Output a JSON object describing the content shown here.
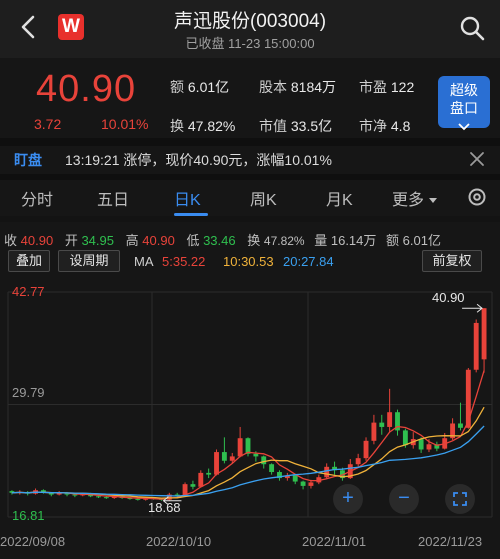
{
  "header": {
    "title": "声迅股份(003004)",
    "subtitle": "已收盘 11-23 15:00:00",
    "logo": "W"
  },
  "quote": {
    "price": "40.90",
    "change": "3.72",
    "change_pct": "10.01%",
    "items": [
      {
        "label": "额",
        "value": "6.01亿"
      },
      {
        "label": "股本",
        "value": "8184万"
      },
      {
        "label": "市盈",
        "value": "122"
      },
      {
        "label": "换",
        "value": "47.82%"
      },
      {
        "label": "市值",
        "value": "33.5亿"
      },
      {
        "label": "市净",
        "value": "4.8"
      }
    ],
    "super_button": {
      "line1": "超级",
      "line2": "盘口",
      "icon": "chevron-down-icon"
    }
  },
  "news": {
    "tag": "盯盘",
    "text": "13:19:21 涨停，现价40.90元，涨幅10.01%"
  },
  "tabs": [
    "分时",
    "五日",
    "日K",
    "周K",
    "月K",
    "更多"
  ],
  "active_tab": "日K",
  "ohlc": [
    {
      "label": "收",
      "value": "40.90",
      "color": "red"
    },
    {
      "label": "开",
      "value": "34.95",
      "color": "green"
    },
    {
      "label": "高",
      "value": "40.90",
      "color": "red"
    },
    {
      "label": "低",
      "value": "33.46",
      "color": "green"
    },
    {
      "label": "换",
      "value": "47.82%",
      "color": "plain"
    },
    {
      "label": "量",
      "value": "16.14万",
      "color": "plain"
    },
    {
      "label": "额",
      "value": "6.01亿",
      "color": "plain"
    }
  ],
  "buttons": {
    "overlay": "叠加",
    "period": "设周期",
    "adjust": "前复权"
  },
  "ma": {
    "label": "MA",
    "ma5": "5:35.22",
    "ma10": "10:30.53",
    "ma20": "20:27.84",
    "c5": "#e8433a",
    "c10": "#f0b23a",
    "c20": "#3aa0f0"
  },
  "chart_data": {
    "type": "candlestick",
    "ylim": [
      16.81,
      42.77
    ],
    "y_labels": [
      "42.77",
      "29.79",
      "16.81"
    ],
    "high_mark": "40.90",
    "low_mark": "18.68",
    "dates": [
      "2022/09/08",
      "2022/10/10",
      "2022/11/01",
      "2022/11/23"
    ],
    "candles": [
      [
        19.8,
        19.6,
        19.9,
        19.4
      ],
      [
        19.6,
        19.7,
        19.9,
        19.4
      ],
      [
        19.7,
        19.5,
        19.8,
        19.3
      ],
      [
        19.5,
        19.9,
        20.1,
        19.4
      ],
      [
        19.9,
        19.6,
        20.0,
        19.5
      ],
      [
        19.6,
        19.4,
        19.7,
        19.2
      ],
      [
        19.4,
        19.6,
        19.8,
        19.3
      ],
      [
        19.6,
        19.4,
        19.7,
        19.2
      ],
      [
        19.4,
        19.3,
        19.5,
        19.1
      ],
      [
        19.3,
        19.5,
        19.6,
        19.2
      ],
      [
        19.5,
        19.2,
        19.6,
        19.1
      ],
      [
        19.2,
        19.1,
        19.3,
        19.0
      ],
      [
        19.1,
        19.0,
        19.2,
        18.9
      ],
      [
        19.0,
        19.2,
        19.3,
        18.9
      ],
      [
        19.2,
        19.0,
        19.3,
        18.9
      ],
      [
        19.0,
        18.9,
        19.1,
        18.8
      ],
      [
        18.9,
        18.8,
        19.0,
        18.7
      ],
      [
        18.8,
        19.0,
        19.1,
        18.7
      ],
      [
        19.0,
        18.9,
        19.1,
        18.8
      ],
      [
        18.9,
        18.8,
        19.0,
        18.68
      ],
      [
        18.8,
        19.4,
        19.6,
        18.7
      ],
      [
        19.4,
        19.2,
        19.6,
        19.0
      ],
      [
        19.2,
        20.6,
        20.8,
        19.1
      ],
      [
        20.6,
        20.3,
        21.0,
        20.0
      ],
      [
        20.3,
        21.9,
        22.2,
        20.2
      ],
      [
        21.9,
        21.7,
        22.4,
        21.3
      ],
      [
        21.7,
        24.3,
        24.6,
        21.6
      ],
      [
        24.3,
        23.3,
        26.0,
        23.0
      ],
      [
        23.3,
        23.8,
        24.2,
        23.0
      ],
      [
        23.8,
        25.9,
        27.2,
        23.7
      ],
      [
        25.9,
        24.1,
        26.0,
        23.8
      ],
      [
        24.1,
        23.8,
        24.4,
        23.2
      ],
      [
        23.8,
        22.9,
        23.9,
        22.4
      ],
      [
        22.9,
        22.0,
        23.0,
        21.7
      ],
      [
        22.0,
        21.3,
        22.2,
        21.0
      ],
      [
        21.3,
        21.6,
        21.9,
        21.0
      ],
      [
        21.6,
        20.9,
        21.8,
        20.6
      ],
      [
        20.9,
        20.4,
        21.0,
        20.0
      ],
      [
        20.4,
        20.8,
        21.1,
        20.1
      ],
      [
        20.8,
        21.4,
        21.7,
        20.6
      ],
      [
        21.4,
        22.6,
        23.0,
        21.2
      ],
      [
        22.6,
        22.2,
        23.2,
        21.7
      ],
      [
        22.2,
        21.3,
        22.5,
        21.0
      ],
      [
        21.3,
        22.9,
        23.5,
        21.2
      ],
      [
        22.9,
        23.6,
        24.1,
        22.6
      ],
      [
        23.6,
        25.6,
        26.0,
        23.3
      ],
      [
        25.6,
        27.7,
        28.6,
        25.2
      ],
      [
        27.7,
        27.2,
        28.6,
        26.3
      ],
      [
        27.2,
        28.9,
        31.6,
        26.6
      ],
      [
        28.9,
        26.8,
        29.2,
        26.2
      ],
      [
        26.8,
        25.1,
        27.0,
        24.8
      ],
      [
        25.1,
        25.8,
        26.6,
        24.7
      ],
      [
        25.8,
        24.6,
        26.0,
        24.2
      ],
      [
        24.6,
        25.2,
        25.8,
        24.3
      ],
      [
        25.2,
        24.7,
        25.5,
        24.4
      ],
      [
        24.7,
        25.9,
        26.5,
        24.6
      ],
      [
        25.9,
        27.6,
        28.2,
        25.7
      ],
      [
        27.6,
        27.1,
        30.0,
        26.8
      ],
      [
        27.1,
        33.8,
        34.0,
        27.0
      ],
      [
        33.8,
        39.2,
        39.6,
        33.5
      ],
      [
        35.0,
        40.9,
        40.9,
        33.46
      ]
    ]
  }
}
